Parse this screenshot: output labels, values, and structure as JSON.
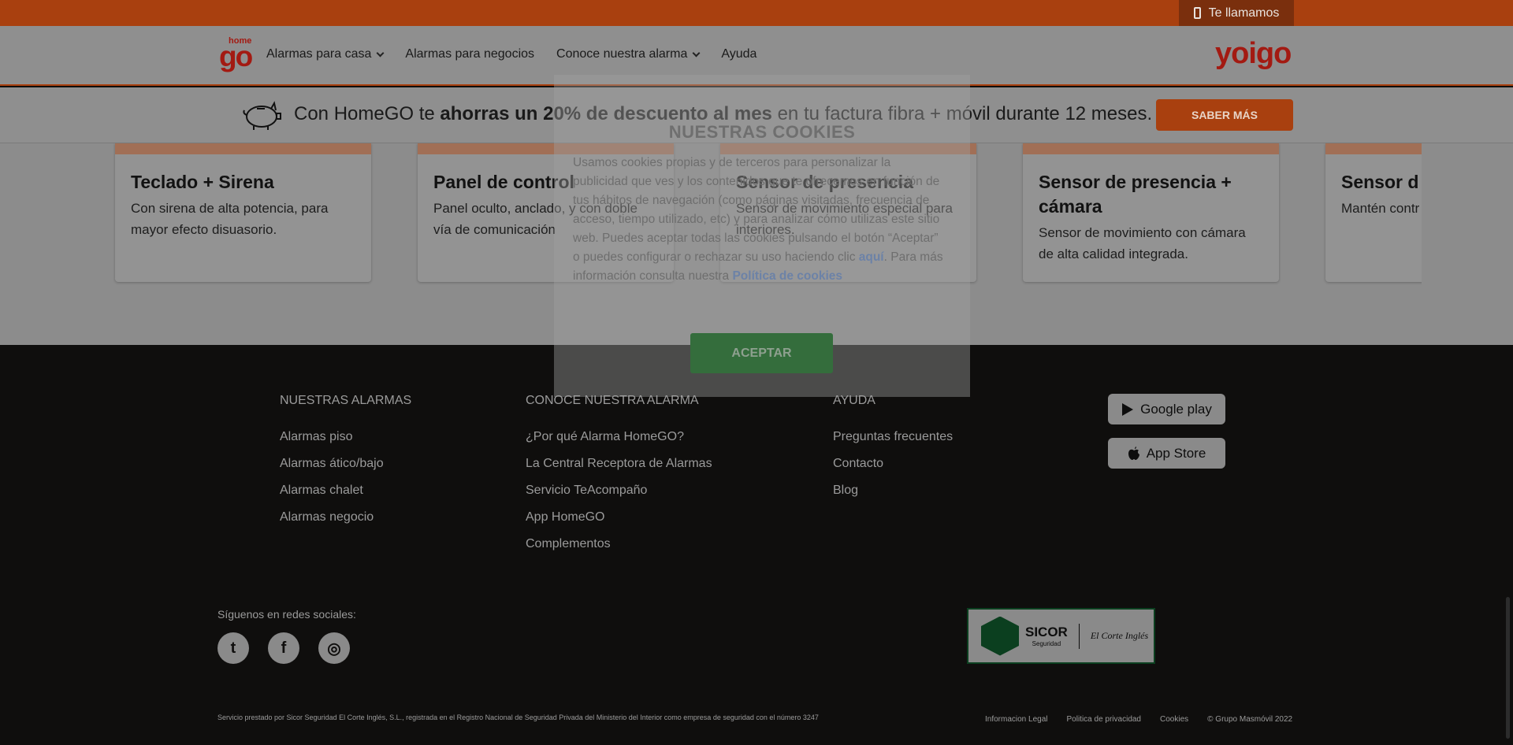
{
  "topbar": {
    "call_label": "Te llamamos"
  },
  "header": {
    "logo_small": "home",
    "logo_big": "go",
    "nav": [
      {
        "label": "Alarmas para casa",
        "dropdown": true
      },
      {
        "label": "Alarmas para negocios",
        "dropdown": false
      },
      {
        "label": "Conoce nuestra alarma",
        "dropdown": true
      },
      {
        "label": "Ayuda",
        "dropdown": false
      }
    ],
    "partner_logo": "yoigo"
  },
  "promo": {
    "text_before": "Con HomeGO te ",
    "text_bold": "ahorras un 20% de descuento al mes",
    "text_after": " en tu factura fibra + móvil durante 12 meses.",
    "button": "SABER MÁS"
  },
  "products": [
    {
      "title": "Teclado + Sirena",
      "desc": "Con sirena de alta potencia, para mayor efecto disuasorio."
    },
    {
      "title": "Panel de control",
      "desc": "Panel oculto, anclado, y con doble vía de comunicación"
    },
    {
      "title": "Sensor de presencia",
      "desc": "Sensor de movimiento especial para interiores."
    },
    {
      "title": "Sensor de presencia + cámara",
      "desc": "Sensor de movimiento con cámara de alta calidad integrada."
    },
    {
      "title": "Sensor d",
      "desc": "Mantén contr"
    }
  ],
  "footer": {
    "columns": [
      {
        "title": "NUESTRAS ALARMAS",
        "links": [
          "Alarmas piso",
          "Alarmas ático/bajo",
          "Alarmas chalet",
          "Alarmas negocio"
        ]
      },
      {
        "title": "CONOCE NUESTRA ALARMA",
        "links": [
          "¿Por qué Alarma HomeGO?",
          "La Central Receptora de Alarmas",
          "Servicio TeAcompaño",
          "App HomeGO",
          "Complementos"
        ]
      },
      {
        "title": "AYUDA",
        "links": [
          "Preguntas frecuentes",
          "Contacto",
          "Blog"
        ]
      }
    ],
    "stores": {
      "google": "Google play",
      "apple": "App Store"
    },
    "social_label": "Síguenos en redes sociales:",
    "social": [
      {
        "name": "twitter-icon",
        "glyph": "t"
      },
      {
        "name": "facebook-icon",
        "glyph": "f"
      },
      {
        "name": "instagram-icon",
        "glyph": "◎"
      }
    ],
    "sicor": {
      "name": "SICOR",
      "sub": "Seguridad",
      "eci": "El Corte Inglés"
    },
    "legal": "Servicio prestado por Sicor Seguridad El Corte Inglés, S.L., registrada en el Registro Nacional de Seguridad Privada del Ministerio del Interior como empresa de seguridad con el número 3247",
    "bottom_links": [
      "Informacion Legal",
      "Politica de privacidad",
      "Cookies",
      "© Grupo Masmóvil 2022"
    ]
  },
  "cookie": {
    "title": "NUESTRAS COOKIES",
    "body_1": "Usamos cookies propias y de terceros para personalizar la publicidad que ves y los contenidos que te ofrecemos en función de tus hábitos de navegación (como páginas visitadas, frecuencia de acceso, tiempo utilizado, etc) y para analizar cómo utilizas este sitio web. Puedes aceptar todas las cookies pulsando el botón “Aceptar” o puedes configurar o rechazar su uso haciendo clic ",
    "link_1": "aquí",
    "body_2": ". Para más información consulta nuestra ",
    "link_2": "Política de cookies",
    "accept": "ACEPTAR"
  },
  "colors": {
    "brand": "#a9400f",
    "accept": "#346d3c"
  }
}
